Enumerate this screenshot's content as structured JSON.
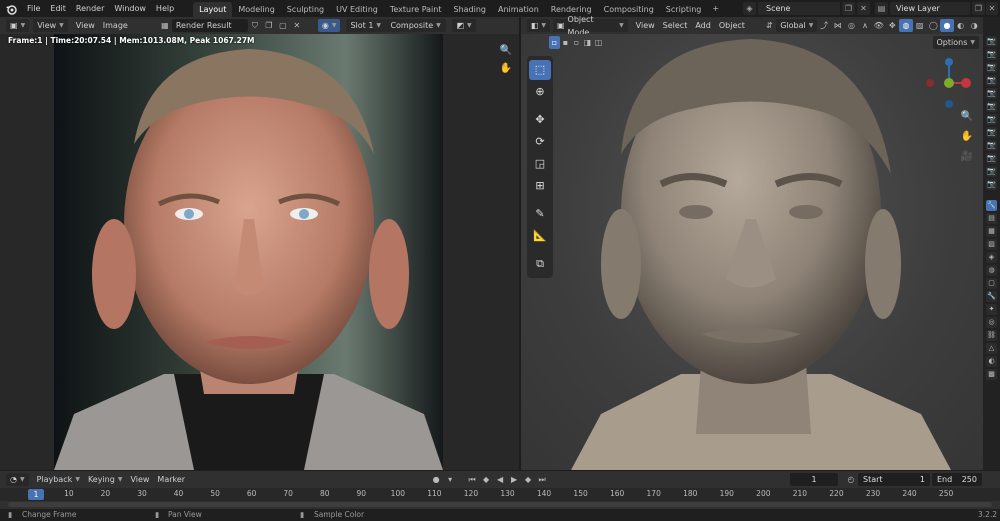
{
  "topbar": {
    "menus": [
      "File",
      "Edit",
      "Render",
      "Window",
      "Help"
    ],
    "workspaces": [
      "Layout",
      "Modeling",
      "Sculpting",
      "UV Editing",
      "Texture Paint",
      "Shading",
      "Animation",
      "Rendering",
      "Compositing",
      "Scripting"
    ],
    "active_workspace": "Layout",
    "add_workspace": "+",
    "scene": "Scene",
    "view_layer": "View Layer"
  },
  "image_editor": {
    "view_menu": "View",
    "menus": [
      "View",
      "Image"
    ],
    "image_name": "Render Result",
    "slot": "Slot 1",
    "pass": "Composite",
    "stats": "Frame:1 | Time:20:07.54 | Mem:1013.08M, Peak 1067.27M"
  },
  "viewport": {
    "mode": "Object Mode",
    "menus": [
      "View",
      "Select",
      "Add",
      "Object"
    ],
    "orientation": "Global",
    "options": "Options"
  },
  "timeline": {
    "menus": [
      "Playback",
      "Keying",
      "View",
      "Marker"
    ],
    "current_frame": "1",
    "start_label": "Start",
    "start": "1",
    "end_label": "End",
    "end": "250",
    "ruler_current": "1",
    "ticks": [
      "10",
      "20",
      "30",
      "40",
      "50",
      "60",
      "70",
      "80",
      "90",
      "100",
      "110",
      "120",
      "130",
      "140",
      "150",
      "160",
      "170",
      "180",
      "190",
      "200",
      "210",
      "220",
      "230",
      "240",
      "250"
    ]
  },
  "statusbar": {
    "change_frame": "Change Frame",
    "pan_view": "Pan View",
    "sample_color": "Sample Color",
    "version": "3.2.2"
  },
  "colors": {
    "accent": "#4772b3",
    "axis_x": "#c2363d",
    "axis_y": "#7dab2b",
    "axis_z": "#2e6fb1"
  }
}
